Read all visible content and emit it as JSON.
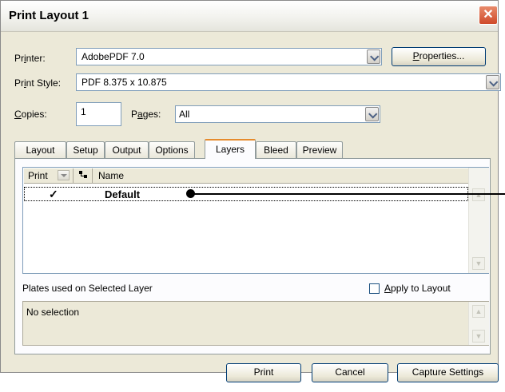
{
  "window": {
    "title": "Print Layout 1",
    "close_glyph": "✕"
  },
  "printer": {
    "label_pre": "Pr",
    "label_ul": "i",
    "label_post": "nter:",
    "value": "AdobePDF 7.0",
    "properties_pre": "",
    "properties_ul": "P",
    "properties_post": "roperties..."
  },
  "print_style": {
    "label_pre": "Pr",
    "label_ul": "i",
    "label_post": "nt Style:",
    "value": "PDF 8.375 x 10.875"
  },
  "copies": {
    "label_ul": "C",
    "label_post": "opies:",
    "value": "1"
  },
  "pages": {
    "label_pre": "P",
    "label_ul": "a",
    "label_post": "ges:",
    "value": "All"
  },
  "tabs": [
    "Layout",
    "Setup",
    "Output",
    "Options",
    "Layers",
    "Bleed",
    "Preview"
  ],
  "active_tab": "Layers",
  "layers_grid": {
    "columns": {
      "print": "Print",
      "name": "Name"
    },
    "rows": [
      {
        "print": "✓",
        "name": "Default"
      }
    ]
  },
  "plates": {
    "label": "Plates used on Selected Layer",
    "apply_ul": "A",
    "apply_post": "pply to Layout",
    "apply_checked": false,
    "content": "No selection"
  },
  "footer": {
    "print": "Print",
    "cancel": "Cancel",
    "capture": "Capture Settings"
  },
  "colors": {
    "tab_highlight": "#e68b2c",
    "dialog_bg": "#ece9d8",
    "close_button": "#cf4a2a"
  }
}
